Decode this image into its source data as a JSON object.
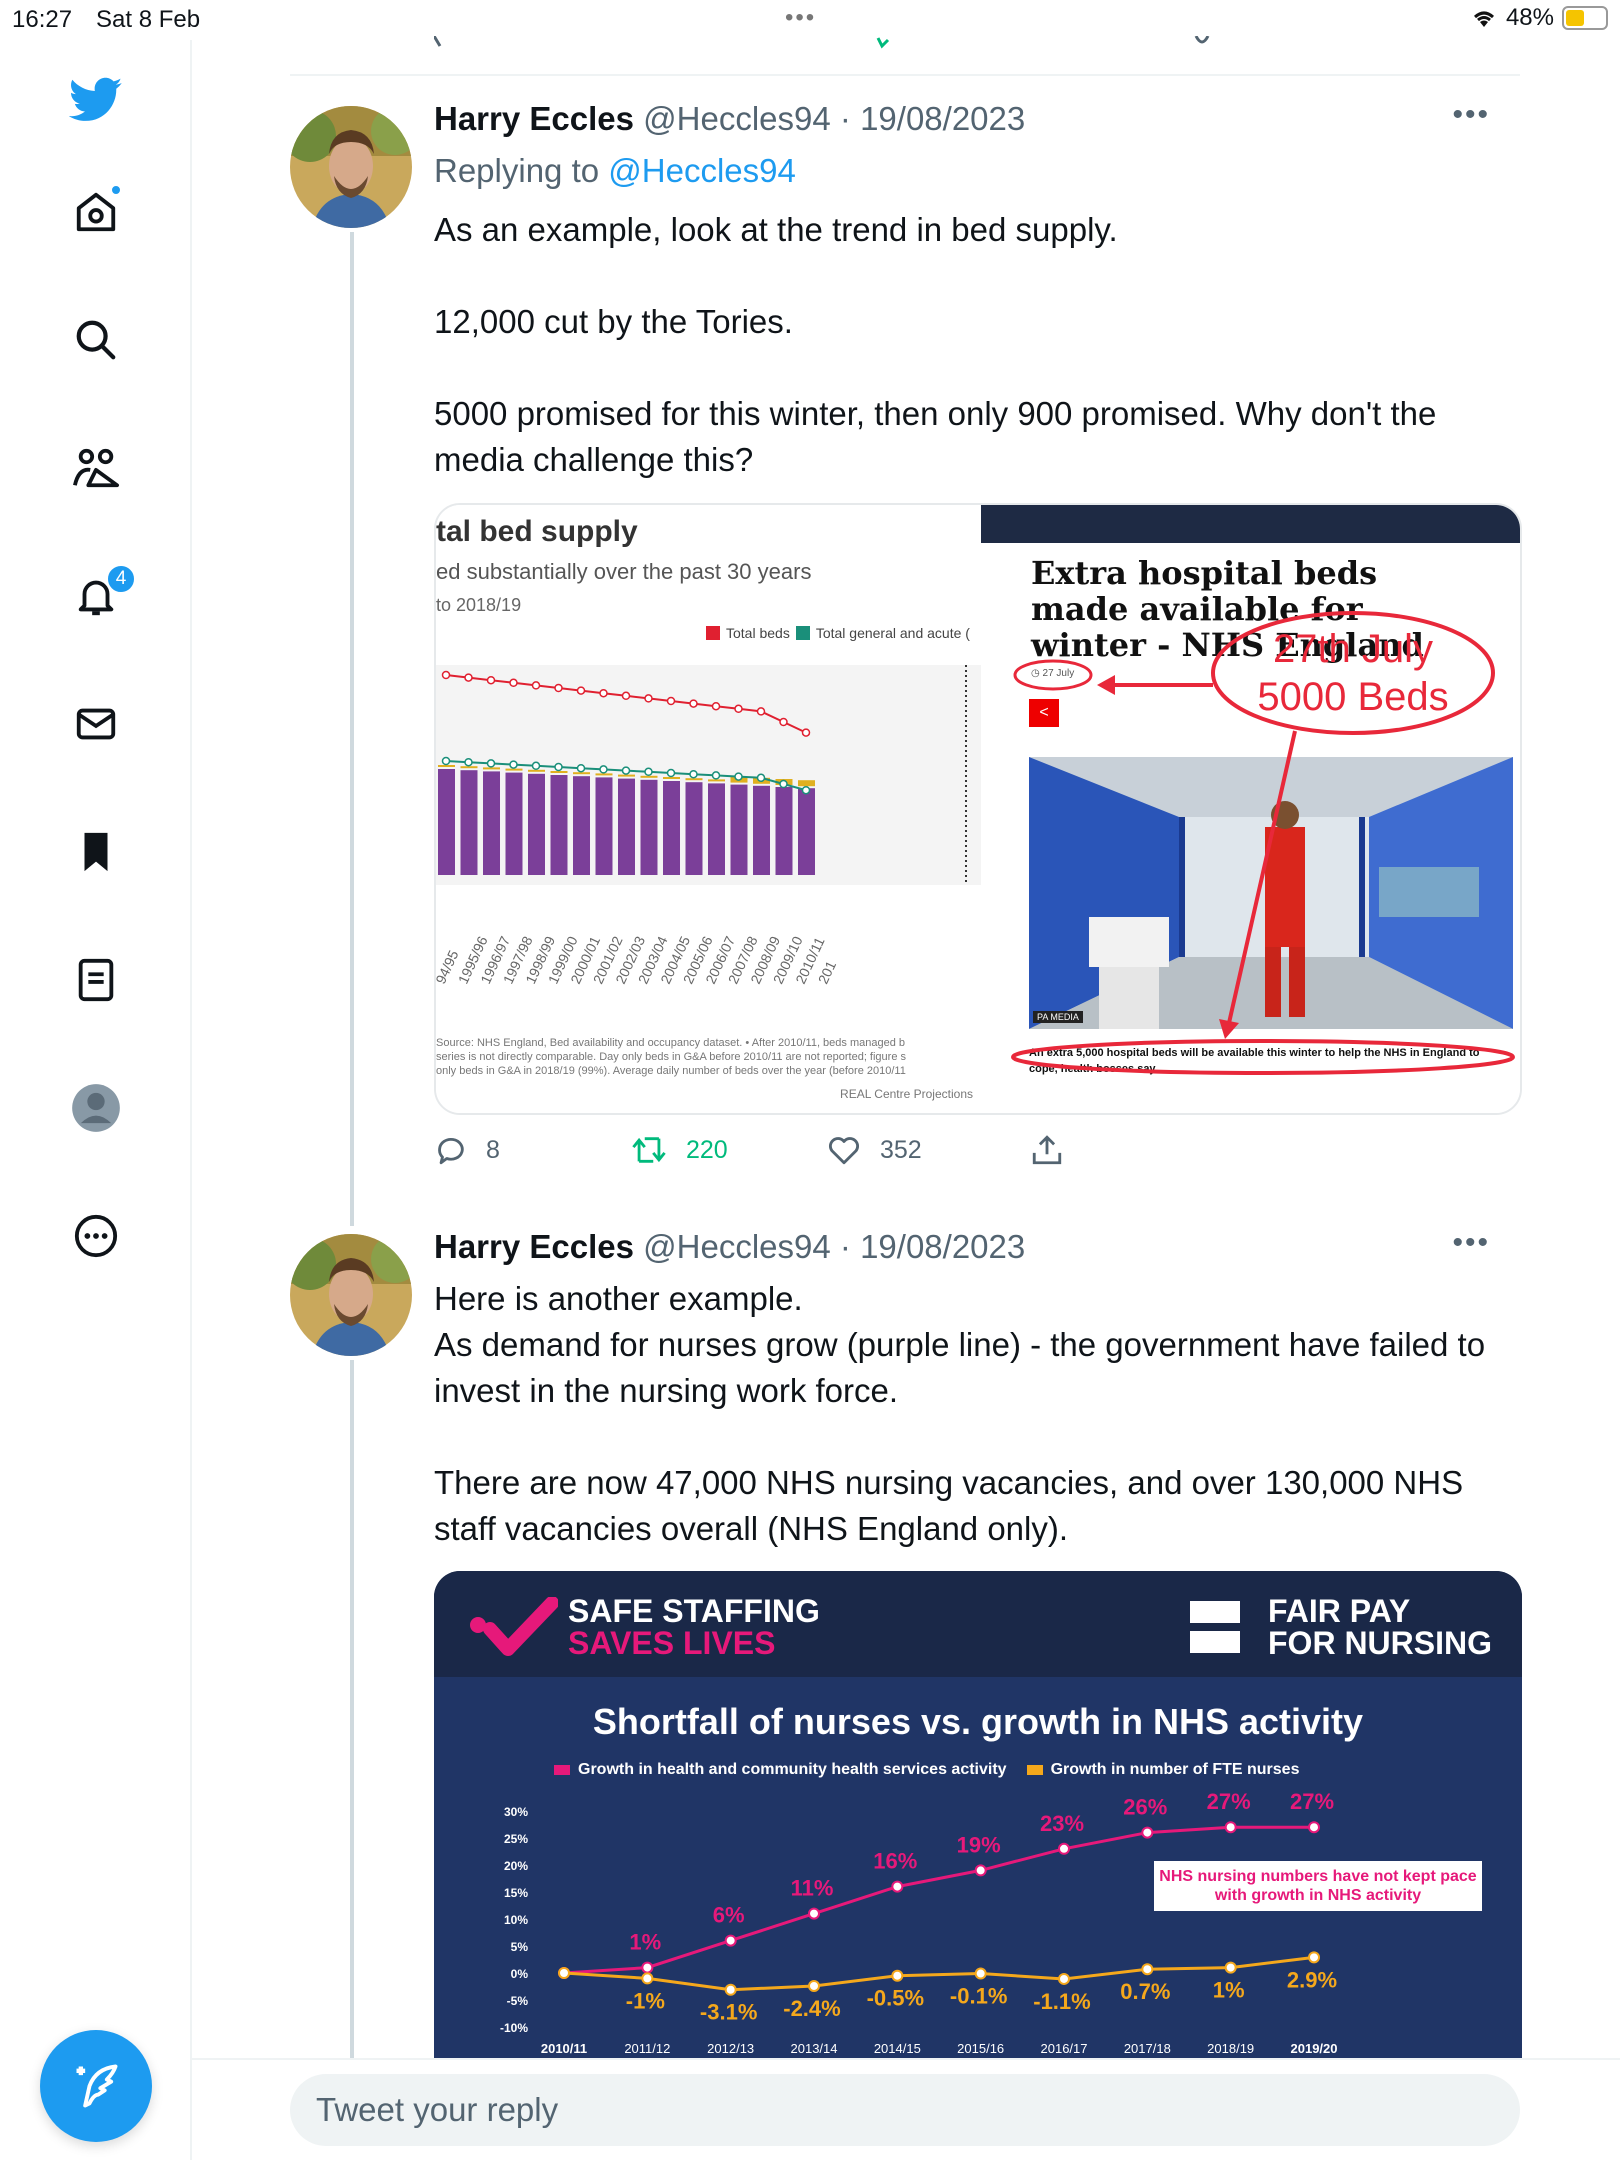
{
  "status": {
    "time": "16:27",
    "date": "Sat 8 Feb",
    "battery": "48%",
    "battery_level": 0.48
  },
  "sidebar": {
    "icons": [
      "twitter-logo-icon",
      "home-icon",
      "search-icon",
      "communities-icon",
      "notifications-icon",
      "messages-icon",
      "bookmarks-icon",
      "lists-icon",
      "profile-icon",
      "more-icon"
    ],
    "notifications_count": "4",
    "compose_icon": "compose-tweet-icon"
  },
  "tweets": [
    {
      "name": "Harry Eccles",
      "handle": "@Heccles94",
      "date": "· 19/08/2023",
      "replying_prefix": "Replying to",
      "replying_handle": "@Heccles94",
      "text": [
        "As an example, look at the trend in bed supply.",
        "",
        "12,000 cut by the Tories.",
        "",
        "5000 promised for this winter, then only 900 promised. Why don't the media challenge this?"
      ],
      "media": {
        "chart": {
          "title": "tal bed supply",
          "subtitle": "ed substantially over the past 30 years",
          "subtitle2": "to 2018/19",
          "legend_total": "Total beds",
          "legend_general": "Total general and acute (",
          "x_labels": [
            "94/95",
            "1995/96",
            "1996/97",
            "1997/98",
            "1998/99",
            "1999/00",
            "2000/01",
            "2001/02",
            "2002/03",
            "2003/04",
            "2004/05",
            "2005/06",
            "2006/07",
            "2007/08",
            "2008/09",
            "2009/10",
            "2010/11",
            "201"
          ],
          "source_1": "Source: NHS England, Bed availability and occupancy dataset. • After 2010/11, beds managed b",
          "source_2": "series is not directly comparable. Day only beds in G&A before 2010/11 are not reported; figure s",
          "source_3": "only beds in G&A in 2018/19 (99%). Average daily number of beds over the year (before 2010/11",
          "credit": "REAL Centre Projections"
        },
        "news": {
          "headline": "Extra hospital beds made available for winter - NHS England",
          "date": "27 July",
          "photo_credit": "PA MEDIA",
          "caption": "An extra 5,000 hospital beds will be available this winter to help the NHS in England to cope, health bosses say.",
          "annotation_1": "27th July",
          "annotation_2": "5000 Beds"
        }
      },
      "actions": {
        "replies": "8",
        "retweets": "220",
        "likes": "352"
      }
    },
    {
      "name": "Harry Eccles",
      "handle": "@Heccles94",
      "date": "· 19/08/2023",
      "text": [
        "Here is another example.",
        "As demand for nurses grow (purple line) - the government have failed to invest in the nursing work force.",
        "",
        "There are now 47,000 NHS nursing vacancies, and over 130,000 NHS staff vacancies overall (NHS England only)."
      ],
      "media": {
        "brand_left_1": "SAFE STAFFING",
        "brand_left_2": "SAVES LIVES",
        "brand_right_1": "FAIR PAY",
        "brand_right_2": "FOR NURSING",
        "title": "Shortfall of nurses vs. growth in NHS activity",
        "legend_1": "Growth in health and community health services activity",
        "legend_2": "Growth in number of FTE nurses",
        "note": "NHS nursing numbers have not kept pace with growth in NHS activity"
      }
    }
  ],
  "chart_data": [
    {
      "type": "line",
      "x": [
        "2010/11",
        "2011/12",
        "2012/13",
        "2013/14",
        "2014/15",
        "2015/16",
        "2016/17",
        "2017/18",
        "2018/19",
        "2019/20"
      ],
      "series": [
        {
          "name": "Growth in health and community health services activity",
          "values": [
            0,
            1,
            6,
            11,
            16,
            19,
            23,
            26,
            27,
            27
          ],
          "labels": [
            "",
            "1%",
            "6%",
            "11%",
            "16%",
            "19%",
            "23%",
            "26%",
            "27%",
            "27%"
          ],
          "color": "#e6197a"
        },
        {
          "name": "Growth in number of FTE nurses",
          "values": [
            0,
            -1,
            -3.1,
            -2.4,
            -0.5,
            -0.1,
            -1.1,
            0.7,
            1,
            2.9
          ],
          "labels": [
            "",
            "-1%",
            "-3.1%",
            "-2.4%",
            "-0.5%",
            "-0.1%",
            "-1.1%",
            "0.7%",
            "1%",
            "2.9%"
          ],
          "color": "#f5a81c"
        }
      ],
      "yticks": [
        "30%",
        "25%",
        "20%",
        "15%",
        "10%",
        "5%",
        "0%",
        "-5%",
        "-10%"
      ],
      "ylim": [
        -10,
        30
      ],
      "title": "Shortfall of nurses vs. growth in NHS activity",
      "grid": false,
      "legend_placement": "top"
    }
  ],
  "reply": {
    "placeholder": "Tweet your reply"
  }
}
